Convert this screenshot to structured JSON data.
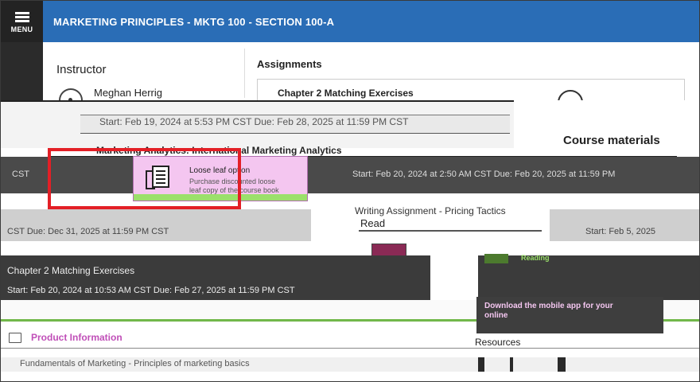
{
  "menu": {
    "label": "MENU",
    "icon": "hamburger-icon"
  },
  "course": {
    "title": "MARKETING PRINCIPLES - MKTG 100 - SECTION 100-A"
  },
  "instructor": {
    "heading": "Instructor",
    "name": "Meghan Herrig",
    "avatar_icon": "user-circle-icon"
  },
  "assignments": {
    "heading": "Assignments",
    "items": [
      {
        "title": "Chapter 2 Matching Exercises",
        "dates": "Start: Feb 19, 2024 at 5:53 PM CST   Due: Feb 28, 2025 at 11:59 PM CST"
      },
      {
        "title": "Marketing Analytics: International Marketing Analytics",
        "dates": "Start: Feb 20, 2024 at 2:50 AM CST   Due: Feb 20, 2025 at 11:59 PM"
      },
      {
        "title": "Writing Assignment - Pricing Tactics",
        "dates": "Start: Feb 5, 2025",
        "partial_dates": "CST   Due: Dec 31, 2025 at 11:59 PM CST"
      },
      {
        "title": "Chapter 2 Matching Exercises",
        "dates": "Start: Feb 20, 2024 at 10:53 AM CST   Due: Feb 27, 2025 at 11:59 PM CST"
      }
    ],
    "left_fragment": "CST"
  },
  "course_materials": {
    "heading": "Course materials",
    "loose_leaf": {
      "title": "Loose leaf option",
      "line1": "Purchase discounted loose",
      "line2": "leaf copy of the course book"
    },
    "read_label": "Read",
    "ebook_label": "Reading",
    "download_line1": "Download the mobile app for your",
    "download_line2": "online",
    "resources_label": "Resources"
  },
  "product_information": {
    "label": "Product Information",
    "description": "Fundamentals of Marketing - Principles of marketing basics"
  },
  "colors": {
    "topbar": "#2a6db6",
    "highlight": "#e31f26",
    "accent_pink": "#f4c6f0",
    "accent_green": "#9be06b"
  }
}
